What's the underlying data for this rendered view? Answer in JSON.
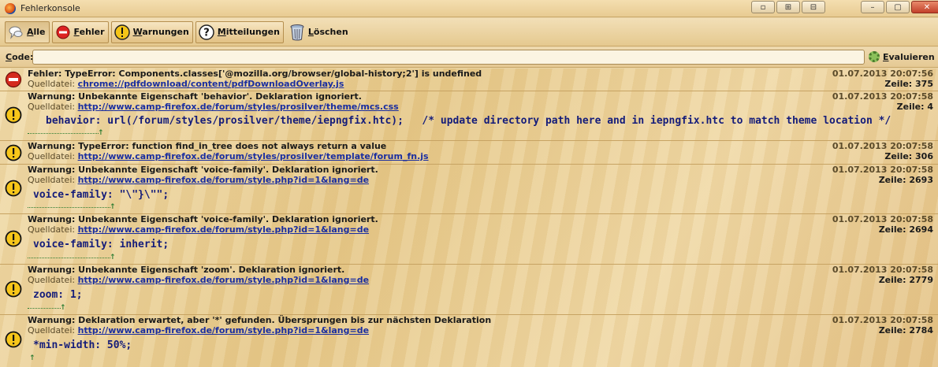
{
  "window": {
    "title": "Fehlerkonsole",
    "controls": [
      "▫",
      "⊞",
      "⊟",
      "–",
      "▢",
      "✕"
    ]
  },
  "toolbar": {
    "all_label": "Alle",
    "errors_label": "Fehler",
    "warnings_label": "Warnungen",
    "messages_label": "Mitteilungen",
    "clear_label": "Löschen"
  },
  "code_row": {
    "label": "Code:",
    "input_value": "",
    "evaluate_label": "Evaluieren"
  },
  "entries": [
    {
      "type": "error",
      "message": "Fehler: TypeError: Components.classes['@mozilla.org/browser/global-history;2'] is undefined",
      "source_label": "Quelldatei:",
      "source": "chrome://pdfdownload/content/pdfDownloadOverlay.js",
      "timestamp": "01.07.2013 20:07:56",
      "line": "Zeile: 375",
      "code": ""
    },
    {
      "type": "warning",
      "message": "Warnung: Unbekannte Eigenschaft 'behavior'.  Deklaration ignoriert.",
      "source_label": "Quelldatei:",
      "source": "http://www.camp-firefox.de/forum/styles/prosilver/theme/mcs.css",
      "timestamp": "01.07.2013 20:07:58",
      "line": "Zeile: 4",
      "code": "behavior: url(/forum/styles/prosilver/theme/iepngfix.htc);   /* update directory path here and in iepngfix.htc to match theme location */"
    },
    {
      "type": "warning",
      "message": "Warnung: TypeError: function find_in_tree does not always return a value",
      "source_label": "Quelldatei:",
      "source": "http://www.camp-firefox.de/forum/styles/prosilver/template/forum_fn.js",
      "timestamp": "01.07.2013 20:07:58",
      "line": "Zeile: 306",
      "code": ""
    },
    {
      "type": "warning",
      "message": "Warnung: Unbekannte Eigenschaft 'voice-family'.  Deklaration ignoriert.",
      "source_label": "Quelldatei:",
      "source": "http://www.camp-firefox.de/forum/style.php?id=1&lang=de",
      "timestamp": "01.07.2013 20:07:58",
      "line": "Zeile: 2693",
      "code": "voice-family: \"\\\"}\\\"\";"
    },
    {
      "type": "warning",
      "message": "Warnung: Unbekannte Eigenschaft 'voice-family'.  Deklaration ignoriert.",
      "source_label": "Quelldatei:",
      "source": "http://www.camp-firefox.de/forum/style.php?id=1&lang=de",
      "timestamp": "01.07.2013 20:07:58",
      "line": "Zeile: 2694",
      "code": "voice-family: inherit;"
    },
    {
      "type": "warning",
      "message": "Warnung: Unbekannte Eigenschaft 'zoom'.  Deklaration ignoriert.",
      "source_label": "Quelldatei:",
      "source": "http://www.camp-firefox.de/forum/style.php?id=1&lang=de",
      "timestamp": "01.07.2013 20:07:58",
      "line": "Zeile: 2779",
      "code": "zoom: 1;"
    },
    {
      "type": "warning",
      "message": "Warnung: Deklaration erwartet, aber '*' gefunden.  Übersprungen bis zur nächsten Deklaration",
      "source_label": "Quelldatei:",
      "source": "http://www.camp-firefox.de/forum/style.php?id=1&lang=de",
      "timestamp": "01.07.2013 20:07:58",
      "line": "Zeile: 2784",
      "code": "*min-width: 50%;"
    }
  ]
}
